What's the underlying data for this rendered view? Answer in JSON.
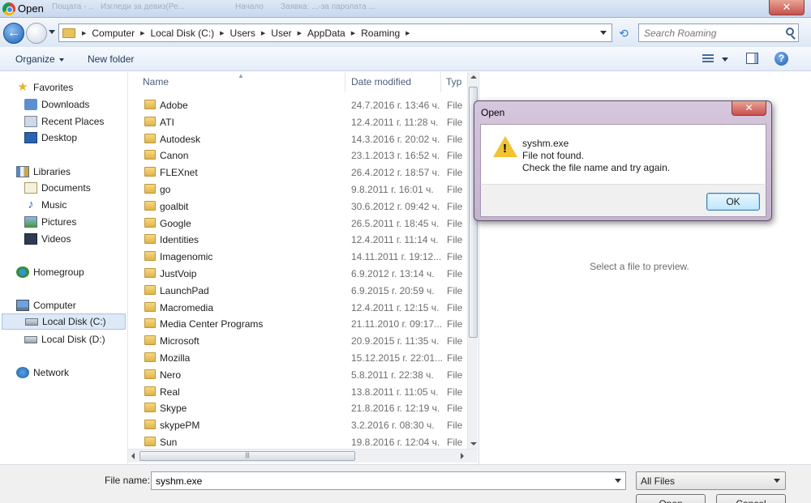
{
  "window": {
    "title": "Open",
    "bg_tabs": [
      "Пощата - ...",
      "Изгледи за девиз(Ре...",
      "Начало",
      "Заявка: ...-за паролата ..."
    ]
  },
  "address": {
    "crumbs": [
      "Computer",
      "Local Disk (C:)",
      "Users",
      "User",
      "AppData",
      "Roaming"
    ],
    "search_placeholder": "Search Roaming"
  },
  "toolbar": {
    "organize": "Organize",
    "new_folder": "New folder"
  },
  "nav": {
    "favorites": "Favorites",
    "downloads": "Downloads",
    "recent": "Recent Places",
    "desktop": "Desktop",
    "libraries": "Libraries",
    "documents": "Documents",
    "music": "Music",
    "pictures": "Pictures",
    "videos": "Videos",
    "homegroup": "Homegroup",
    "computer": "Computer",
    "disk_c": "Local Disk (C:)",
    "disk_d": "Local Disk (D:)",
    "network": "Network"
  },
  "columns": {
    "name": "Name",
    "date": "Date modified",
    "type": "Typ"
  },
  "files": [
    {
      "name": "Adobe",
      "date": "24.7.2016 г. 13:46 ч.",
      "type": "File"
    },
    {
      "name": "ATI",
      "date": "12.4.2011 г. 11:28 ч.",
      "type": "File"
    },
    {
      "name": "Autodesk",
      "date": "14.3.2016 г. 20:02 ч.",
      "type": "File"
    },
    {
      "name": "Canon",
      "date": "23.1.2013 г. 16:52 ч.",
      "type": "File"
    },
    {
      "name": "FLEXnet",
      "date": "26.4.2012 г. 18:57 ч.",
      "type": "File"
    },
    {
      "name": "go",
      "date": "9.8.2011 г. 16:01 ч.",
      "type": "File"
    },
    {
      "name": "goalbit",
      "date": "30.6.2012 г. 09:42 ч.",
      "type": "File"
    },
    {
      "name": "Google",
      "date": "26.5.2011 г. 18:45 ч.",
      "type": "File"
    },
    {
      "name": "Identities",
      "date": "12.4.2011 г. 11:14 ч.",
      "type": "File"
    },
    {
      "name": "Imagenomic",
      "date": "14.11.2011 г. 19:12...",
      "type": "File"
    },
    {
      "name": "JustVoip",
      "date": "6.9.2012 г. 13:14 ч.",
      "type": "File"
    },
    {
      "name": "LaunchPad",
      "date": "6.9.2015 г. 20:59 ч.",
      "type": "File"
    },
    {
      "name": "Macromedia",
      "date": "12.4.2011 г. 12:15 ч.",
      "type": "File"
    },
    {
      "name": "Media Center Programs",
      "date": "21.11.2010 г. 09:17...",
      "type": "File"
    },
    {
      "name": "Microsoft",
      "date": "20.9.2015 г. 11:35 ч.",
      "type": "File"
    },
    {
      "name": "Mozilla",
      "date": "15.12.2015 г. 22:01...",
      "type": "File"
    },
    {
      "name": "Nero",
      "date": "5.8.2011 г. 22:38 ч.",
      "type": "File"
    },
    {
      "name": "Real",
      "date": "13.8.2011 г. 11:05 ч.",
      "type": "File"
    },
    {
      "name": "Skype",
      "date": "21.8.2016 г. 12:19 ч.",
      "type": "File"
    },
    {
      "name": "skypePM",
      "date": "3.2.2016 г. 08:30 ч.",
      "type": "File"
    },
    {
      "name": "Sun",
      "date": "19.8.2016 г. 12:04 ч.",
      "type": "File"
    }
  ],
  "preview": {
    "text": "Select a file to preview."
  },
  "bottom": {
    "filename_label": "File name:",
    "filename_value": "syshm.exe",
    "filetype": "All Files",
    "open": "Open",
    "cancel": "Cancel"
  },
  "dialog": {
    "title": "Open",
    "file": "syshm.exe",
    "line1": "File not found.",
    "line2": "Check the file name and try again.",
    "ok": "OK"
  },
  "colors": {
    "titlebar": "#c6d7ee",
    "dialog_frame": "#c3b3cd",
    "close_red": "#c75050",
    "ok_blue": "#bee6fd"
  }
}
